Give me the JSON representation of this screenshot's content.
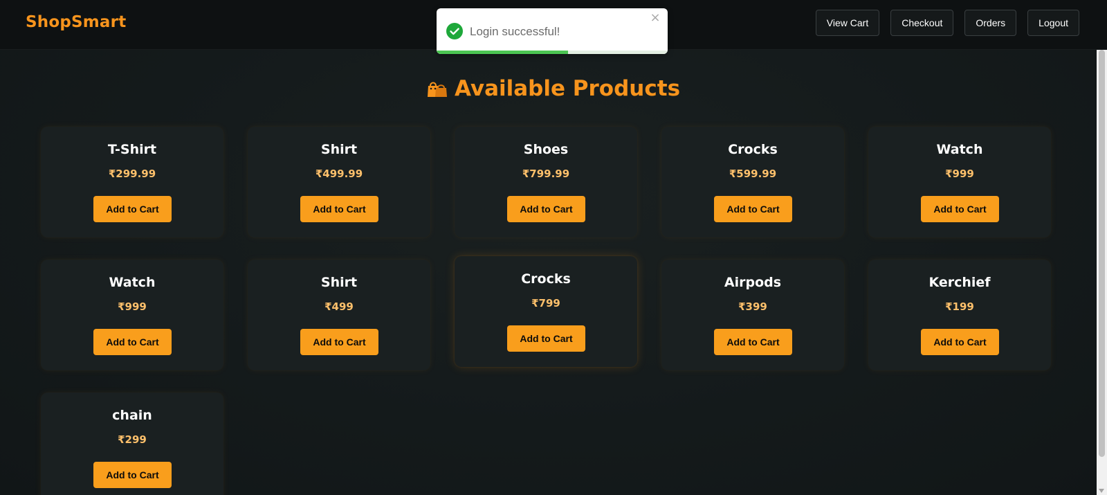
{
  "app": {
    "brand": "ShopSmart"
  },
  "nav": {
    "buttons": [
      {
        "label": "View Cart"
      },
      {
        "label": "Checkout"
      },
      {
        "label": "Orders"
      },
      {
        "label": "Logout"
      }
    ]
  },
  "toast": {
    "message": "Login successful!",
    "close_symbol": "×",
    "progress_fraction": 0.57,
    "icon": "check-circle-icon",
    "color": "#1ea83a"
  },
  "page": {
    "heading": "Available Products",
    "heading_icon": "shopping-bags-icon",
    "accent": "#f7941d"
  },
  "products": [
    {
      "name": "T-Shirt",
      "price": "₹299.99",
      "button": "Add to Cart"
    },
    {
      "name": "Shirt",
      "price": "₹499.99",
      "button": "Add to Cart"
    },
    {
      "name": "Shoes",
      "price": "₹799.99",
      "button": "Add to Cart"
    },
    {
      "name": "Crocks",
      "price": "₹599.99",
      "button": "Add to Cart"
    },
    {
      "name": "Watch",
      "price": "₹999",
      "button": "Add to Cart"
    },
    {
      "name": "Watch",
      "price": "₹999",
      "button": "Add to Cart"
    },
    {
      "name": "Shirt",
      "price": "₹499",
      "button": "Add to Cart"
    },
    {
      "name": "Crocks",
      "price": "₹799",
      "button": "Add to Cart"
    },
    {
      "name": "Airpods",
      "price": "₹399",
      "button": "Add to Cart"
    },
    {
      "name": "Kerchief",
      "price": "₹199",
      "button": "Add to Cart"
    },
    {
      "name": "chain",
      "price": "₹299",
      "button": "Add to Cart"
    }
  ]
}
